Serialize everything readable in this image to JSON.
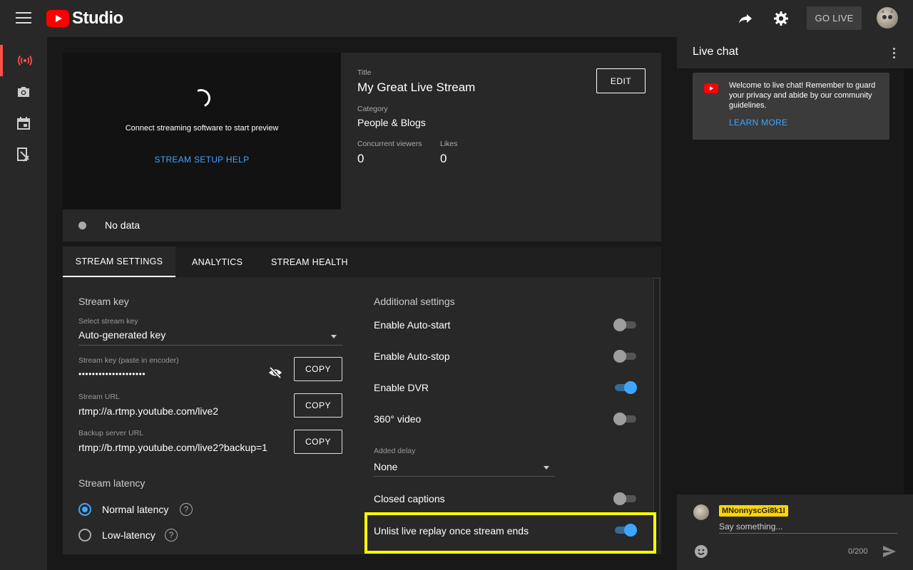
{
  "app": {
    "logo_text": "Studio"
  },
  "topbar": {
    "go_live_label": "GO LIVE"
  },
  "preview": {
    "message": "Connect streaming software to start preview",
    "setup_help": "STREAM SETUP HELP"
  },
  "stream_info": {
    "title_label": "Title",
    "title_value": "My Great Live Stream",
    "category_label": "Category",
    "category_value": "People & Blogs",
    "viewers_label": "Concurrent viewers",
    "viewers_value": "0",
    "likes_label": "Likes",
    "likes_value": "0",
    "edit_label": "EDIT"
  },
  "status": {
    "text": "No data"
  },
  "tabs": [
    {
      "label": "STREAM SETTINGS"
    },
    {
      "label": "ANALYTICS"
    },
    {
      "label": "STREAM HEALTH"
    }
  ],
  "stream_key": {
    "section_title": "Stream key",
    "select_label": "Select stream key",
    "select_value": "Auto-generated key",
    "key_label": "Stream key (paste in encoder)",
    "key_value": "••••••••••••••••••••",
    "url_label": "Stream URL",
    "url_value": "rtmp://a.rtmp.youtube.com/live2",
    "backup_label": "Backup server URL",
    "backup_value": "rtmp://b.rtmp.youtube.com/live2?backup=1",
    "copy_label": "COPY"
  },
  "latency": {
    "section_title": "Stream latency",
    "options": [
      {
        "label": "Normal latency",
        "selected": true
      },
      {
        "label": "Low-latency",
        "selected": false
      }
    ],
    "help_glyph": "?"
  },
  "additional": {
    "section_title": "Additional settings",
    "toggles": [
      {
        "label": "Enable Auto-start",
        "on": false
      },
      {
        "label": "Enable Auto-stop",
        "on": false
      },
      {
        "label": "Enable DVR",
        "on": true
      },
      {
        "label": "360° video",
        "on": false
      }
    ],
    "delay_label": "Added delay",
    "delay_value": "None",
    "captions": {
      "label": "Closed captions",
      "on": false
    },
    "unlist": {
      "label": "Unlist live replay once stream ends",
      "on": true
    }
  },
  "chat": {
    "title": "Live chat",
    "welcome_text": "Welcome to live chat! Remember to guard your privacy and abide by our community guidelines.",
    "learn_more": "LEARN MORE",
    "username": "MNonnyscGi8k1I",
    "placeholder": "Say something...",
    "char_count": "0/200"
  },
  "colors": {
    "accent": "#3ea6ff",
    "brand": "#ff0000",
    "highlight": "#ffff00",
    "live_nav": "#ff4e45"
  }
}
